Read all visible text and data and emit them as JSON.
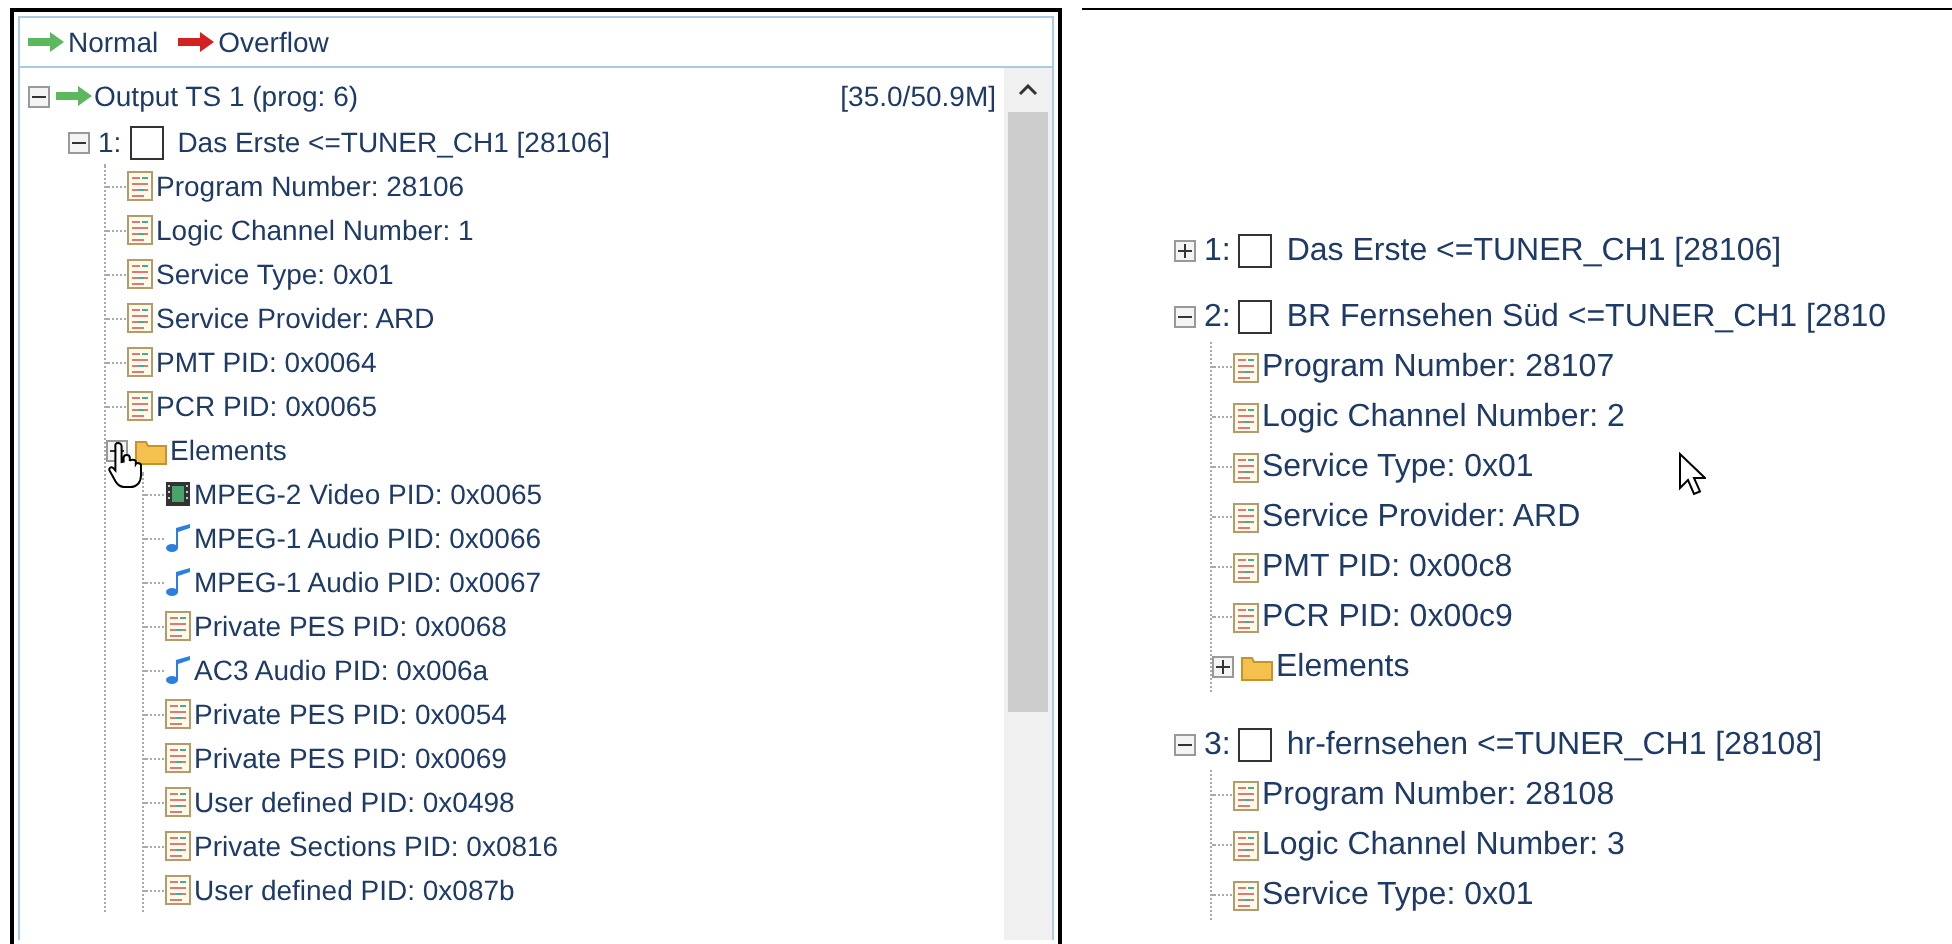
{
  "left_panel": {
    "legend": [
      {
        "kind": "normal",
        "label": "Normal"
      },
      {
        "kind": "overflow",
        "label": "Overflow"
      }
    ],
    "tree": {
      "label": "Output TS 1 (prog: 6)",
      "rate": "[35.0/50.9M]",
      "expanded": true,
      "children": [
        {
          "kind": "program",
          "number": "1:",
          "label": "Das Erste <=TUNER_CH1 [28106]",
          "checked": false,
          "expanded": true,
          "children": [
            {
              "kind": "info",
              "label": "Program Number: 28106"
            },
            {
              "kind": "info",
              "label": "Logic Channel Number: 1"
            },
            {
              "kind": "info",
              "label": "Service Type: 0x01"
            },
            {
              "kind": "info",
              "label": "Service Provider: ARD"
            },
            {
              "kind": "info",
              "label": "PMT PID: 0x0064"
            },
            {
              "kind": "info",
              "label": "PCR PID: 0x0065"
            },
            {
              "kind": "folder",
              "label": "Elements",
              "expanded": true,
              "children": [
                {
                  "kind": "video",
                  "label": "MPEG-2 Video PID: 0x0065"
                },
                {
                  "kind": "audio",
                  "label": "MPEG-1 Audio PID: 0x0066"
                },
                {
                  "kind": "audio",
                  "label": "MPEG-1 Audio PID: 0x0067"
                },
                {
                  "kind": "info",
                  "label": "Private PES PID: 0x0068"
                },
                {
                  "kind": "audio",
                  "label": "AC3 Audio PID: 0x006a"
                },
                {
                  "kind": "info",
                  "label": "Private PES PID: 0x0054"
                },
                {
                  "kind": "info",
                  "label": "Private PES PID: 0x0069"
                },
                {
                  "kind": "info",
                  "label": "User defined PID: 0x0498"
                },
                {
                  "kind": "info",
                  "label": "Private Sections PID: 0x0816"
                },
                {
                  "kind": "info",
                  "label": "User defined PID: 0x087b"
                }
              ]
            }
          ]
        }
      ]
    }
  },
  "right_panel": {
    "tree": [
      {
        "kind": "program",
        "number": "1:",
        "label": "Das Erste <=TUNER_CH1 [28106]",
        "checked": false,
        "expanded": false
      },
      {
        "kind": "program",
        "number": "2:",
        "label": "BR Fernsehen Süd <=TUNER_CH1 [2810",
        "checked": false,
        "expanded": true,
        "children": [
          {
            "kind": "info",
            "label": "Program Number: 28107"
          },
          {
            "kind": "info",
            "label": "Logic Channel Number: 2"
          },
          {
            "kind": "info",
            "label": "Service Type: 0x01"
          },
          {
            "kind": "info",
            "label": "Service Provider: ARD"
          },
          {
            "kind": "info",
            "label": "PMT PID: 0x00c8"
          },
          {
            "kind": "info",
            "label": "PCR PID: 0x00c9"
          },
          {
            "kind": "folder",
            "label": "Elements",
            "expanded": false
          }
        ]
      },
      {
        "kind": "program",
        "number": "3:",
        "label": "hr-fernsehen <=TUNER_CH1 [28108]",
        "checked": false,
        "expanded": true,
        "children": [
          {
            "kind": "info",
            "label": "Program Number: 28108"
          },
          {
            "kind": "info",
            "label": "Logic Channel Number: 3"
          },
          {
            "kind": "info",
            "label": "Service Type: 0x01"
          }
        ]
      }
    ]
  }
}
